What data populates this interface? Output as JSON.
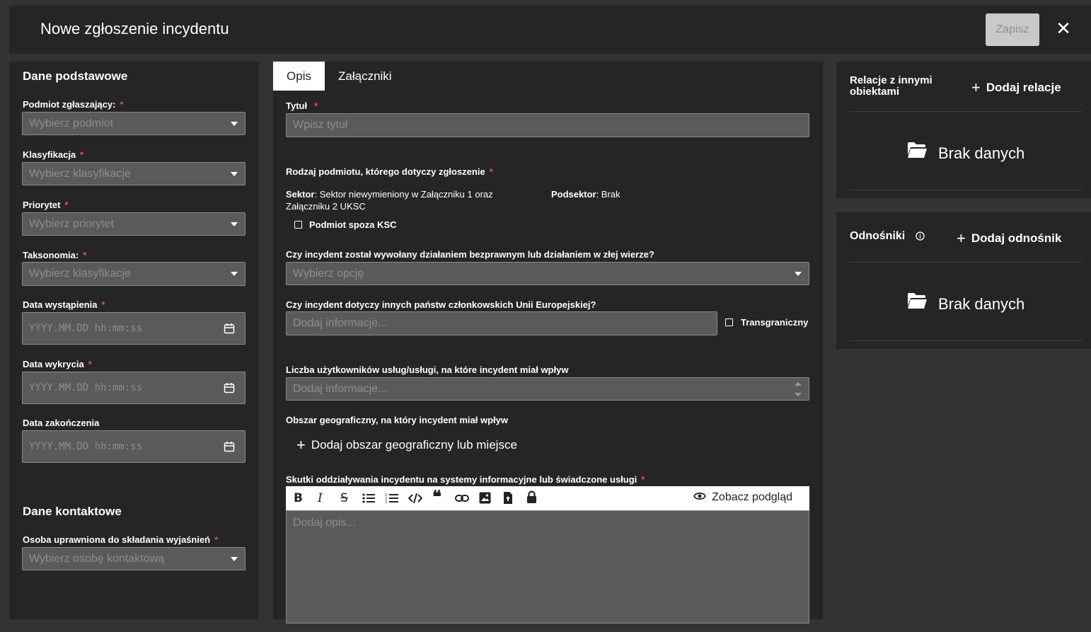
{
  "header": {
    "title": "Nowe zgłoszenie incydentu",
    "save_label": "Zapisz",
    "close_glyph": "✕"
  },
  "required_mark": "*",
  "left": {
    "section_basic": "Dane podstawowe",
    "reporting_entity": {
      "label": "Podmiot zgłaszający:",
      "placeholder": "Wybierz podmiot"
    },
    "classification": {
      "label": "Klasyfikacja",
      "placeholder": "Wybierz klasyfikacje"
    },
    "priority": {
      "label": "Priorytet",
      "placeholder": "Wybierz priorytet"
    },
    "taxonomy": {
      "label": "Taksonomia:",
      "placeholder": "Wybierz klasyfikacje"
    },
    "occurrence_date": {
      "label": "Data wystąpienia",
      "placeholder": "YYYY.MM.DD hh:mm:ss"
    },
    "detection_date": {
      "label": "Data wykrycia",
      "placeholder": "YYYY.MM.DD hh:mm:ss"
    },
    "end_date": {
      "label": "Data zakończenia",
      "placeholder": "YYYY.MM.DD hh:mm:ss"
    },
    "section_contact": "Dane kontaktowe",
    "contact_person": {
      "label": "Osoba uprawniona do składania wyjaśnień",
      "placeholder": "Wybierz osobę kontaktową"
    }
  },
  "middle": {
    "tabs": [
      {
        "label": "Opis",
        "active": true
      },
      {
        "label": "Załączniki",
        "active": false
      }
    ],
    "title_field": {
      "label": "Tytuł",
      "placeholder": "Wpisz tytuł"
    },
    "entity_type": {
      "label": "Rodzaj podmiotu, którego dotyczy zgłoszenie",
      "sector_key": "Sektor",
      "sector_value": ": Sektor niewymieniony w Załączniku 1 oraz",
      "sector_value_line2": "Załączniku 2 UKSC",
      "subsector_key": "Podsektor",
      "subsector_value": ": Brak",
      "outside_ksc_label": "Podmiot spoza KSC"
    },
    "unlawful": {
      "label": "Czy incydent został wywołany działaniem bezprawnym lub działaniem w złej wierze?",
      "placeholder": "Wybierz opcję"
    },
    "other_states": {
      "label": "Czy incydent dotyczy innych państw członkowskich Unii Europejskiej?",
      "placeholder": "Dodaj informacje...",
      "checkbox_label": "Transgraniczny"
    },
    "users_count": {
      "label": "Liczba użytkowników usług/usługi, na które incydent miał wpływ",
      "placeholder": "Dodaj informacje..."
    },
    "geo_area": {
      "label": "Obszar geograficzny, na który incydent miał wpływ",
      "add_label": "Dodaj obszar geograficzny lub miejsce"
    },
    "effects": {
      "label": "Skutki oddziaływania incydentu na systemy informacyjne lub świadczone usługi",
      "preview_label": "Zobacz podgląd",
      "editor_placeholder": "Dodaj opis...",
      "toolbar_icons": [
        "bold-icon",
        "italic-icon",
        "strikethrough-icon",
        "bullet-list-icon",
        "numbered-list-icon",
        "code-icon",
        "quote-icon",
        "link-icon",
        "image-icon",
        "file-upload-icon",
        "lock-icon"
      ]
    }
  },
  "right": {
    "relations": {
      "title": "Relacje z innymi obiektami",
      "title_line1": "Relacje z innymi",
      "title_line2": "obiektami",
      "add_label": "Dodaj relacje",
      "empty_label": "Brak danych"
    },
    "references": {
      "title": "Odnośniki",
      "add_label": "Dodaj odnośnik",
      "empty_label": "Brak danych"
    }
  },
  "colors": {
    "background": "#333333",
    "panel": "#252525",
    "input": "#5a5a5a",
    "required": "#e05050",
    "save_disabled": "#c9c9c9"
  }
}
